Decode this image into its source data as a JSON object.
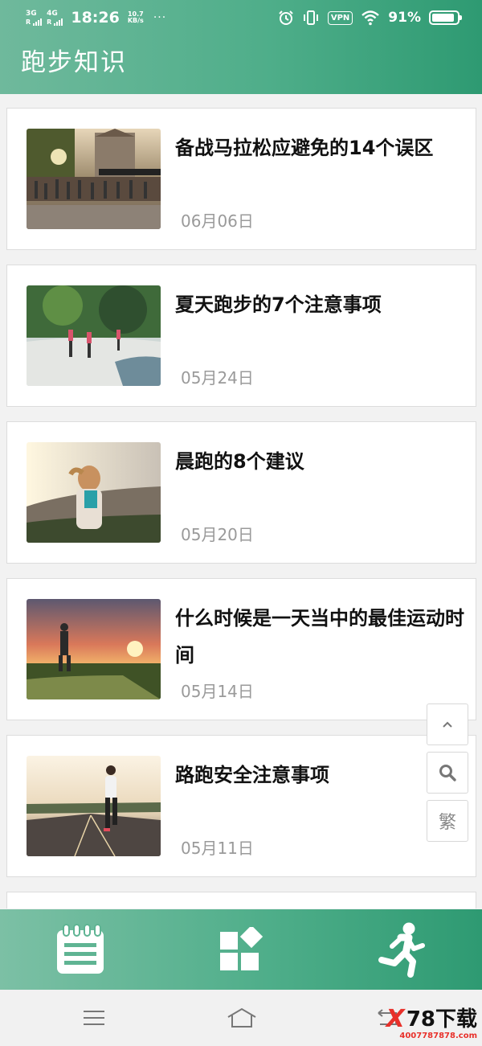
{
  "status_bar": {
    "network1": "3G",
    "network2": "4G",
    "time": "18:26",
    "speed_value": "10.7",
    "speed_unit": "KB/s",
    "dots": "···",
    "vpn": "VPN",
    "battery_pct": "91%",
    "battery_level": 0.91
  },
  "header": {
    "title": "跑步知识"
  },
  "articles": [
    {
      "title": "备战马拉松应避免的14个误区",
      "date": "06月06日",
      "thumb": "marathon-start-photo"
    },
    {
      "title": "夏天跑步的7个注意事项",
      "date": "05月24日",
      "thumb": "park-runners-photo"
    },
    {
      "title": "晨跑的8个建议",
      "date": "05月20日",
      "thumb": "morning-runner-photo"
    },
    {
      "title": "什么时候是一天当中的最佳运动时间",
      "date": "05月14日",
      "thumb": "sunset-runner-photo"
    },
    {
      "title": "路跑安全注意事项",
      "date": "05月11日",
      "thumb": "road-runner-photo"
    }
  ],
  "floating": {
    "top_icon": "chevron-up-icon",
    "search_icon": "search-icon",
    "traditional_label": "繁"
  },
  "tabbar": {
    "tabs": [
      {
        "icon": "notepad-icon"
      },
      {
        "icon": "grid-apps-icon"
      },
      {
        "icon": "running-person-icon"
      }
    ],
    "color_start": "#7cc0a5",
    "color_end": "#2e9a72"
  },
  "watermark": {
    "x": "X",
    "brand": "78下载",
    "url": "4007787878.com"
  },
  "colors": {
    "accent": "#4fae8a",
    "date": "#9a9a9a"
  }
}
